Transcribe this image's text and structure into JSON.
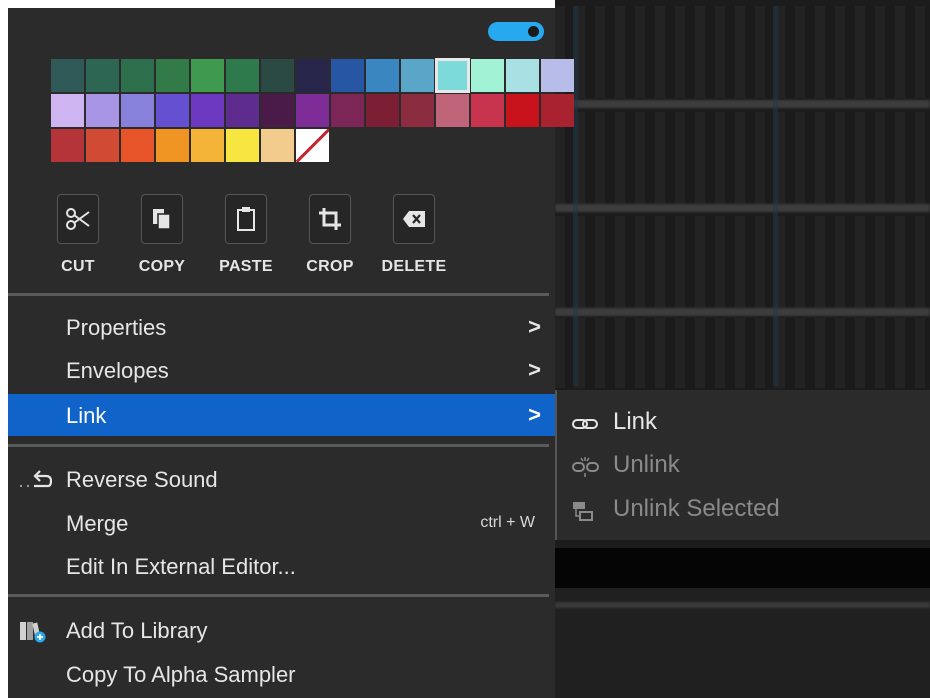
{
  "toggle": {
    "on": true,
    "color": "#27a9f0"
  },
  "palette": {
    "selected_index": 11,
    "colors": [
      "#2f5a58",
      "#2e6654",
      "#2d6f4d",
      "#327a48",
      "#3f9a4f",
      "#2f7a4c",
      "#2b4a44",
      "#28254a",
      "#2756a4",
      "#3a86c0",
      "#5aa6c8",
      "#7cdada",
      "#a2f2d6",
      "#a8e0e4",
      "#b7bde8",
      "#ceb4f0",
      "#a995e6",
      "#8781dc",
      "#6450d0",
      "#6c38c0",
      "#5e2c8e",
      "#4a1b48",
      "#7e2c98",
      "#7c2658",
      "#7c1e34",
      "#8c2c40",
      "#c0647a",
      "#c8344e",
      "#c8121c",
      "#a82230",
      "#b4343a",
      "#d04a34",
      "#e8542a",
      "#f09424",
      "#f4b438",
      "#f8e640",
      "#f2cc8c",
      "none"
    ]
  },
  "tools": [
    {
      "id": "cut",
      "label": "CUT",
      "icon": "scissors-icon"
    },
    {
      "id": "copy",
      "label": "COPY",
      "icon": "copy-icon"
    },
    {
      "id": "paste",
      "label": "PASTE",
      "icon": "clipboard-icon"
    },
    {
      "id": "crop",
      "label": "CROP",
      "icon": "crop-icon"
    },
    {
      "id": "delete",
      "label": "DELETE",
      "icon": "backspace-icon"
    }
  ],
  "menu": {
    "properties": {
      "label": "Properties",
      "submenu_indicator": ">"
    },
    "envelopes": {
      "label": "Envelopes",
      "submenu_indicator": ">"
    },
    "link": {
      "label": "Link",
      "submenu_indicator": ">",
      "highlighted": true
    },
    "reverse_sound": {
      "label": "Reverse Sound",
      "icon": "reverse-arrow-icon"
    },
    "merge": {
      "label": "Merge",
      "shortcut": "ctrl + W"
    },
    "edit_external": {
      "label": "Edit In External Editor..."
    },
    "add_library": {
      "label": "Add To Library",
      "icon": "library-add-icon"
    },
    "copy_alpha": {
      "label": "Copy To Alpha Sampler"
    }
  },
  "submenu": {
    "link": {
      "label": "Link",
      "icon": "link-icon",
      "enabled": true
    },
    "unlink": {
      "label": "Unlink",
      "icon": "unlink-icon",
      "enabled": false
    },
    "unlink_selected": {
      "label": "Unlink Selected",
      "icon": "unlink-selected-icon",
      "enabled": false
    }
  },
  "colors": {
    "menu_bg": "#2b2b2b",
    "highlight": "#0f63c9",
    "text": "#e6e6e6",
    "disabled_text": "#8a8a8a"
  }
}
